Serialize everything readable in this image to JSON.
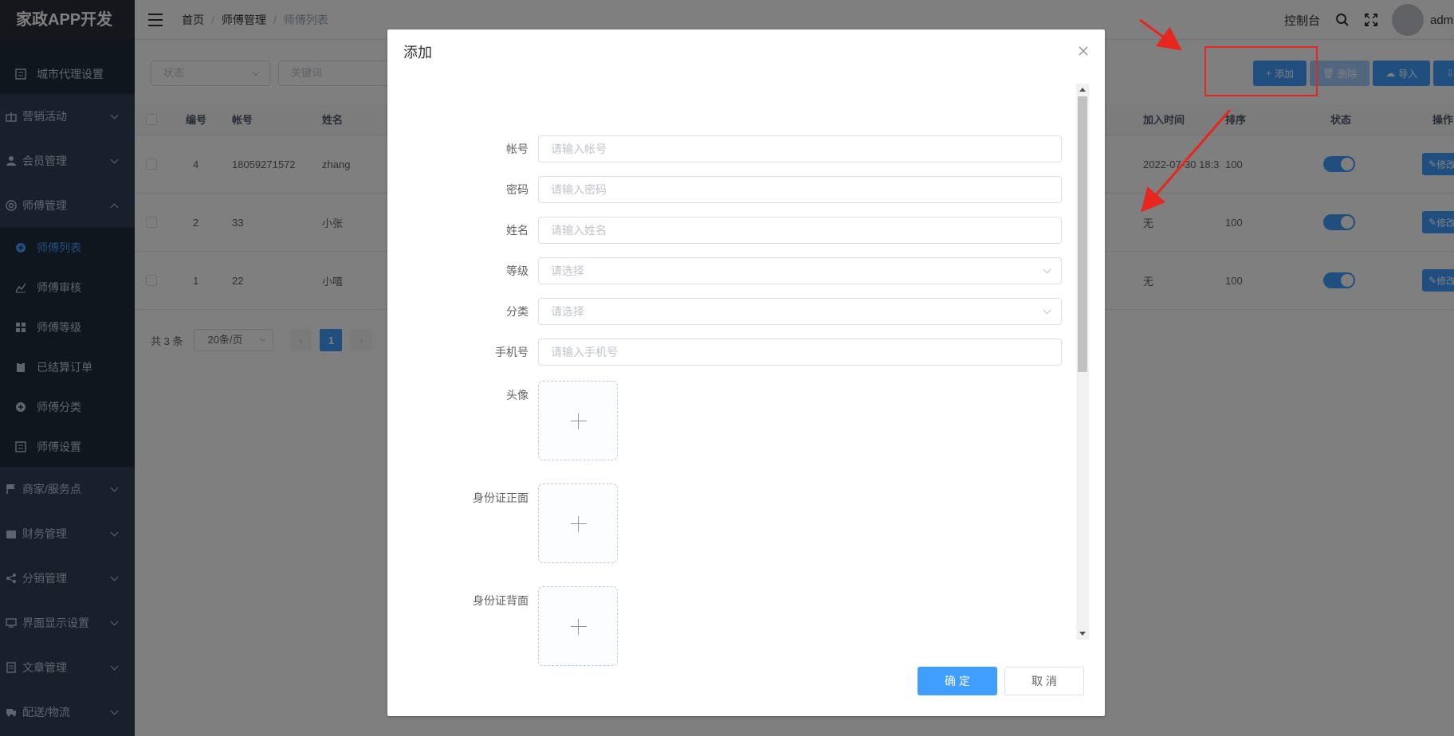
{
  "app": {
    "logo": "家政APP开发"
  },
  "sidebar": {
    "items": [
      {
        "label": "城市代理设置",
        "sub": true
      },
      {
        "label": "营销活动"
      },
      {
        "label": "会员管理"
      },
      {
        "label": "师傅管理",
        "expanded": true
      },
      {
        "label": "师傅列表",
        "sub": true,
        "active": true
      },
      {
        "label": "师傅审核",
        "sub": true
      },
      {
        "label": "师傅等级",
        "sub": true
      },
      {
        "label": "已结算订单",
        "sub": true
      },
      {
        "label": "师傅分类",
        "sub": true
      },
      {
        "label": "师傅设置",
        "sub": true
      },
      {
        "label": "商家/服务点"
      },
      {
        "label": "财务管理"
      },
      {
        "label": "分销管理"
      },
      {
        "label": "界面显示设置"
      },
      {
        "label": "文章管理"
      },
      {
        "label": "配送/物流"
      }
    ]
  },
  "navbar": {
    "breadcrumb": [
      "首页",
      "师傅管理",
      "师傅列表"
    ],
    "console": "控制台",
    "username": "admin"
  },
  "filters": {
    "status_placeholder": "状态",
    "keyword_placeholder": "关键词"
  },
  "toolbar": {
    "add": "添加",
    "delete": "删除",
    "import": "导入"
  },
  "table": {
    "headers": {
      "id": "编号",
      "account": "帐号",
      "name": "姓名",
      "join_time": "加入时间",
      "sort": "排序",
      "status": "状态",
      "action": "操作"
    },
    "rows": [
      {
        "id": "4",
        "account": "18059271572",
        "name": "zhang",
        "join_time": "2022-07-30 18:3",
        "sort": "100",
        "edit": "修改"
      },
      {
        "id": "2",
        "account": "33",
        "name": "小张",
        "join_time": "无",
        "sort": "100",
        "edit": "修改"
      },
      {
        "id": "1",
        "account": "22",
        "name": "小嘻",
        "join_time": "无",
        "sort": "100",
        "edit": "修改"
      }
    ]
  },
  "pagination": {
    "total": "共 3 条",
    "page_size": "20条/页",
    "current": "1"
  },
  "dialog": {
    "title": "添加",
    "fields": [
      {
        "label": "帐号",
        "placeholder": "请输入帐号",
        "type": "input"
      },
      {
        "label": "密码",
        "placeholder": "请输入密码",
        "type": "input"
      },
      {
        "label": "姓名",
        "placeholder": "请输入姓名",
        "type": "input"
      },
      {
        "label": "等级",
        "placeholder": "请选择",
        "type": "select"
      },
      {
        "label": "分类",
        "placeholder": "请选择",
        "type": "select"
      },
      {
        "label": "手机号",
        "placeholder": "请输入手机号",
        "type": "input"
      }
    ],
    "uploads": [
      {
        "label": "头像"
      },
      {
        "label": "身份证正面"
      },
      {
        "label": "身份证背面"
      }
    ],
    "confirm": "确 定",
    "cancel": "取 消"
  },
  "colors": {
    "primary": "#409eff",
    "sidebar_bg": "#304156",
    "annotation_red": "#e6261f"
  }
}
